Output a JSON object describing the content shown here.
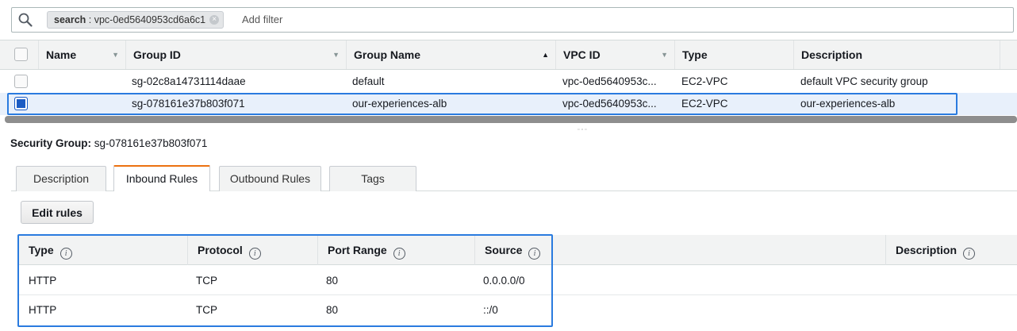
{
  "search": {
    "token_key": "search",
    "token_value": " : vpc-0ed5640953cd6a6c1",
    "add_filter_placeholder": "Add filter"
  },
  "grid": {
    "columns": [
      "Name",
      "Group ID",
      "Group Name",
      "VPC ID",
      "Type",
      "Description"
    ],
    "rows": [
      {
        "name": "",
        "group_id": "sg-02c8a14731114daae",
        "group_name": "default",
        "vpc_id": "vpc-0ed5640953c...",
        "type": "EC2-VPC",
        "description": "default VPC security group",
        "selected": false
      },
      {
        "name": "",
        "group_id": "sg-078161e37b803f071",
        "group_name": "our-experiences-alb",
        "vpc_id": "vpc-0ed5640953c...",
        "type": "EC2-VPC",
        "description": "our-experiences-alb",
        "selected": true
      }
    ]
  },
  "detail": {
    "title_label": "Security Group:",
    "title_value": " sg-078161e37b803f071",
    "tabs": [
      "Description",
      "Inbound Rules",
      "Outbound Rules",
      "Tags"
    ],
    "active_tab": "Inbound Rules",
    "edit_rules_label": "Edit rules"
  },
  "inbound": {
    "columns": [
      "Type",
      "Protocol",
      "Port Range",
      "Source",
      "Description"
    ],
    "rows": [
      {
        "type": "HTTP",
        "protocol": "TCP",
        "port_range": "80",
        "source": "0.0.0.0/0",
        "description": ""
      },
      {
        "type": "HTTP",
        "protocol": "TCP",
        "port_range": "80",
        "source": "::/0",
        "description": ""
      }
    ]
  },
  "colors": {
    "accent": "#ec7211",
    "selection_outline": "#2a7bdf",
    "checkbox_checked": "#1c5cc4"
  }
}
